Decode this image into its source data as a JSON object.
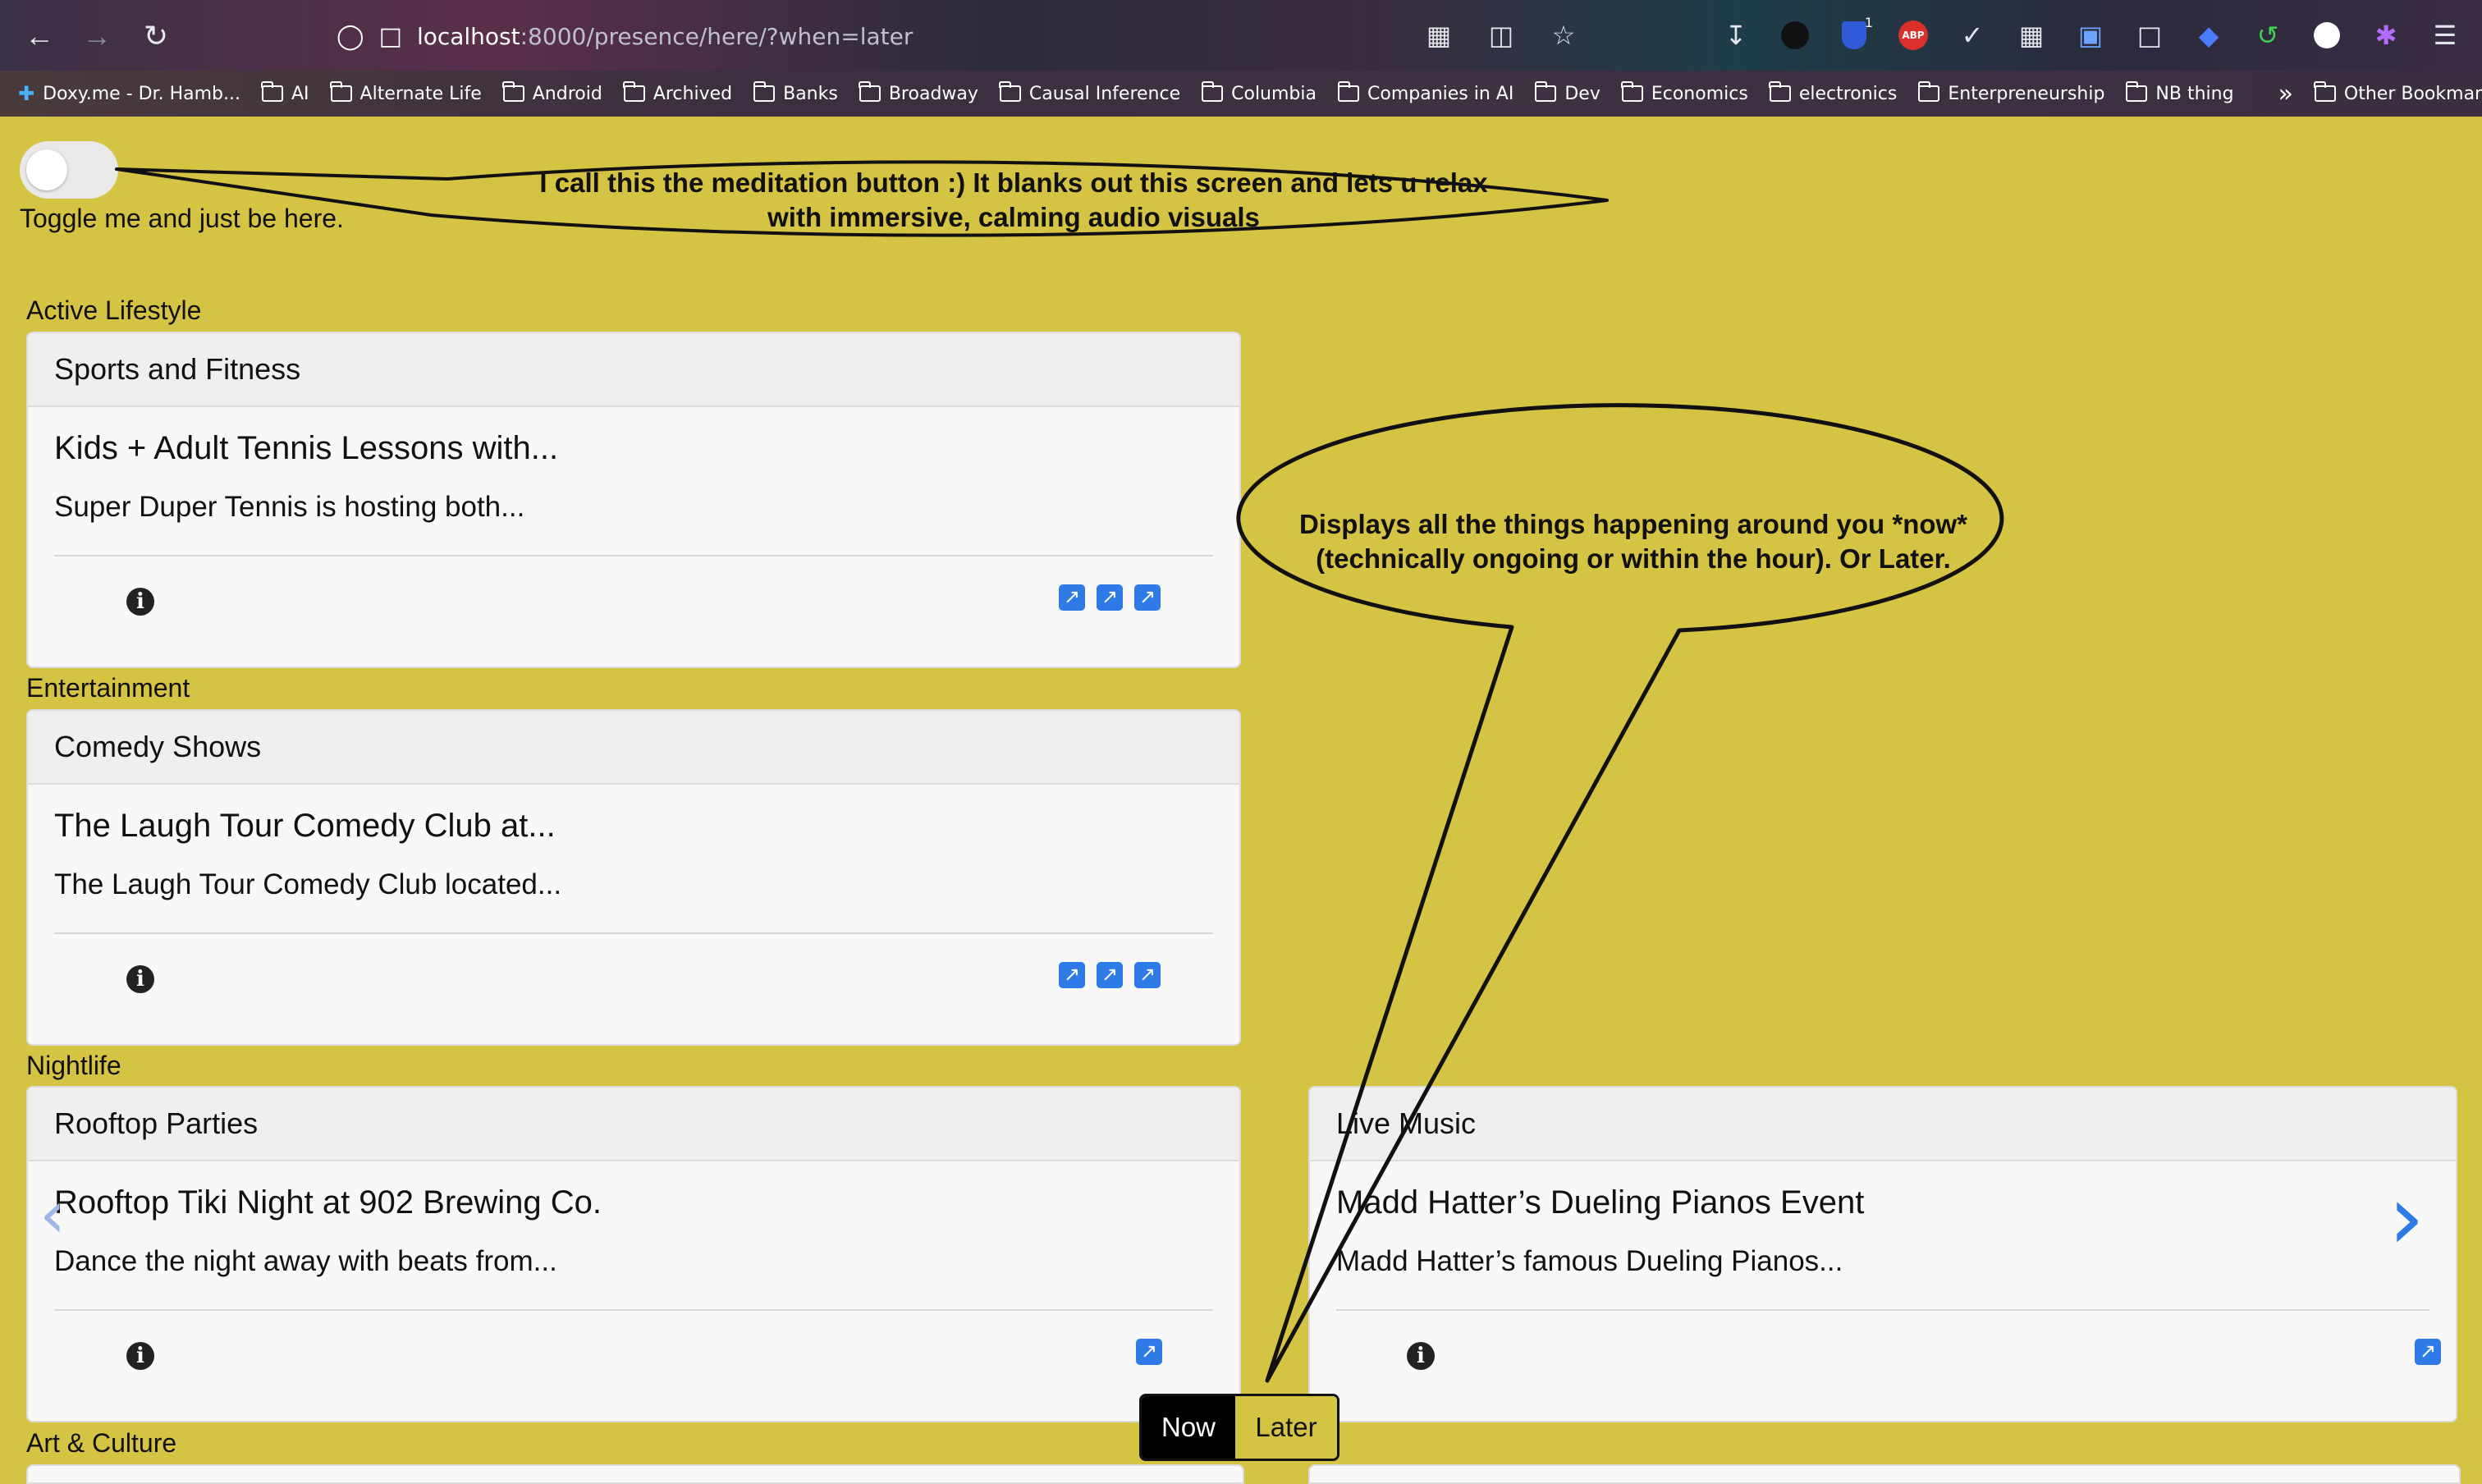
{
  "browser": {
    "url_host": "localhost",
    "url_rest": ":8000/presence/here/?when=later",
    "bookmarks": [
      "Doxy.me - Dr. Hamb...",
      "AI",
      "Alternate Life",
      "Android",
      "Archived",
      "Banks",
      "Broadway",
      "Causal Inference",
      "Columbia",
      "Companies in AI",
      "Dev",
      "Economics",
      "electronics",
      "Enterpreneurship",
      "NB thing"
    ],
    "other_bookmarks": "Other Bookmarks",
    "abp_label": "ABP",
    "shield_badge": "1"
  },
  "meditation": {
    "toggle_label": "Toggle me and just be here.",
    "toggle_on": false
  },
  "sections": [
    {
      "title": "Active Lifestyle",
      "cards": [
        {
          "category": "Sports and Fitness",
          "title": "Kids + Adult Tennis Lessons with...",
          "description": "Super Duper Tennis is hosting both...",
          "links": 3
        }
      ]
    },
    {
      "title": "Entertainment",
      "cards": [
        {
          "category": "Comedy Shows",
          "title": "The Laugh Tour Comedy Club at...",
          "description": "The Laugh Tour Comedy Club located...",
          "links": 3
        }
      ]
    },
    {
      "title": "Nightlife",
      "cards": [
        {
          "category": "Rooftop Parties",
          "title": "Rooftop Tiki Night at 902 Brewing Co.",
          "description": "Dance the night away with beats from...",
          "links": 1
        },
        {
          "category": "Live Music",
          "title": "Madd Hatter’s Dueling Pianos Event",
          "description": "Madd Hatter’s famous Dueling Pianos...",
          "links": 1
        }
      ]
    },
    {
      "title": "Art & Culture",
      "cards": []
    }
  ],
  "toggle_when": {
    "now_label": "Now",
    "later_label": "Later",
    "selected": "Now"
  },
  "annotations": {
    "meditation_note": "I call this the meditation button :) It blanks out this screen and lets u relax with immersive, calming audio visuals",
    "now_later_note": "Displays all the things happening around you *now* (technically ongoing or within the hour). Or Later."
  },
  "colors": {
    "page_bg": "#d5c343",
    "link_blue": "#2e7ae6",
    "card_bg": "#f8f8f8",
    "header_bg": "#efefef"
  },
  "icons": {
    "info": "info-icon",
    "link": "external-link-icon",
    "prev": "chevron-left-icon",
    "next": "chevron-right-icon"
  }
}
